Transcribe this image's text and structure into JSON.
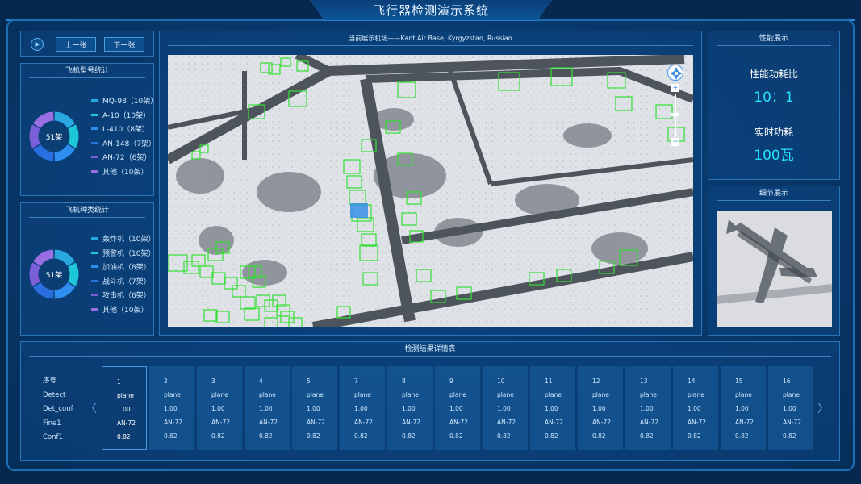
{
  "header": {
    "title": "飞行器检测演示系统"
  },
  "controls": {
    "prev_label": "上一张",
    "next_label": "下一张"
  },
  "model_stats": {
    "title": "飞机型号统计",
    "total": "51架",
    "legend": [
      {
        "label": "MQ-98（10架）",
        "color": "#29a8e0"
      },
      {
        "label": "A-10（10架）",
        "color": "#1ec7d8"
      },
      {
        "label": "L-410（8架）",
        "color": "#2f8ff0"
      },
      {
        "label": "AN-148（7架）",
        "color": "#2a6fe0"
      },
      {
        "label": "AN-72（6架）",
        "color": "#7a5fd8"
      },
      {
        "label": "其他（10架）",
        "color": "#9a6fe6"
      }
    ]
  },
  "type_stats": {
    "title": "飞机种类统计",
    "total": "51架",
    "legend": [
      {
        "label": "轰炸机（10架）",
        "color": "#29a8e0"
      },
      {
        "label": "预警机（10架）",
        "color": "#1ec7d8"
      },
      {
        "label": "加油机（8架）",
        "color": "#2f8ff0"
      },
      {
        "label": "战斗机（7架）",
        "color": "#2a6fe0"
      },
      {
        "label": "攻击机（6架）",
        "color": "#7a5fd8"
      },
      {
        "label": "其他（10架）",
        "color": "#9a6fe6"
      }
    ]
  },
  "map": {
    "title": "当前展示机场——Kant Air Base, Kyrgyzstan, Russian",
    "zoom_in": "+",
    "zoom_out": "−"
  },
  "performance": {
    "title": "性能展示",
    "ratio_label": "性能功耗比",
    "ratio_value": "10：1",
    "power_label": "实时功耗",
    "power_value": "100瓦"
  },
  "detail": {
    "title": "细节展示"
  },
  "results": {
    "title": "检测结果详情表",
    "row_headers": [
      "序号",
      "Detect",
      "Det_conf",
      "Fine1",
      "Conf1"
    ],
    "columns": [
      {
        "id": "1",
        "detect": "plane",
        "det_conf": "1.00",
        "fine1": "AN-72",
        "conf1": "0.82"
      },
      {
        "id": "2",
        "detect": "plane",
        "det_conf": "1.00",
        "fine1": "AN-72",
        "conf1": "0.82"
      },
      {
        "id": "3",
        "detect": "plane",
        "det_conf": "1.00",
        "fine1": "AN-72",
        "conf1": "0.82"
      },
      {
        "id": "4",
        "detect": "plane",
        "det_conf": "1.00",
        "fine1": "AN-72",
        "conf1": "0.82"
      },
      {
        "id": "5",
        "detect": "plane",
        "det_conf": "1.00",
        "fine1": "AN-72",
        "conf1": "0.82"
      },
      {
        "id": "7",
        "detect": "plane",
        "det_conf": "1.00",
        "fine1": "AN-72",
        "conf1": "0.82"
      },
      {
        "id": "8",
        "detect": "plane",
        "det_conf": "1.00",
        "fine1": "AN-72",
        "conf1": "0.82"
      },
      {
        "id": "9",
        "detect": "plane",
        "det_conf": "1.00",
        "fine1": "AN-72",
        "conf1": "0.82"
      },
      {
        "id": "10",
        "detect": "plane",
        "det_conf": "1.00",
        "fine1": "AN-72",
        "conf1": "0.82"
      },
      {
        "id": "11",
        "detect": "plane",
        "det_conf": "1.00",
        "fine1": "AN-72",
        "conf1": "0.82"
      },
      {
        "id": "12",
        "detect": "plane",
        "det_conf": "1.00",
        "fine1": "AN-72",
        "conf1": "0.82"
      },
      {
        "id": "13",
        "detect": "plane",
        "det_conf": "1.00",
        "fine1": "AN-72",
        "conf1": "0.82"
      },
      {
        "id": "14",
        "detect": "plane",
        "det_conf": "1.00",
        "fine1": "AN-72",
        "conf1": "0.82"
      },
      {
        "id": "15",
        "detect": "plane",
        "det_conf": "1.00",
        "fine1": "AN-72",
        "conf1": "0.82"
      },
      {
        "id": "16",
        "detect": "plane",
        "det_conf": "1.00",
        "fine1": "AN-72",
        "conf1": "0.82"
      }
    ],
    "prev_arrow": "〈",
    "next_arrow": "〉"
  },
  "colors": {
    "accent": "#25e0ff",
    "detection_box": "#33e033",
    "selected_box": "#3b8fe8"
  }
}
